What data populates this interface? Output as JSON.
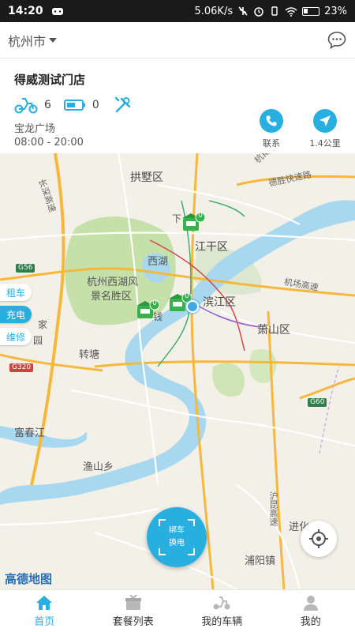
{
  "status_bar": {
    "time": "14:20",
    "speed": "5.06K/s",
    "battery": "23%"
  },
  "header": {
    "city": "杭州市"
  },
  "store": {
    "name": "得威测试门店",
    "vehicle_count": "6",
    "battery_count": "0",
    "address": "宝龙广场",
    "hours": "08:00 - 20:00",
    "actions": {
      "contact_label": "联系",
      "distance_label": "1.4公里"
    }
  },
  "map": {
    "labels": {
      "gongshu": "拱墅区",
      "jianggan": "江干区",
      "xihu": "西湖",
      "scenic_1": "杭州西湖风",
      "scenic_2": "景名胜区",
      "binjiang": "滨江区",
      "xiaoshan": "萧山区",
      "zhuantang": "转塘",
      "fuchunjiang": "富春江",
      "yushan": "渔山乡",
      "puyang": "浦阳镇",
      "jinhua": "进化",
      "changshen": "长深高速",
      "desheng": "德胜快速路",
      "airport": "机场高速",
      "hangyong": "杭甬高",
      "hukun": "沪昆高速",
      "qian": "钱",
      "xia": "下",
      "jia": "家",
      "yuan": "园"
    },
    "shields": {
      "g56": "G56",
      "g320": "G320",
      "g60": "G60"
    },
    "side_tabs": [
      "租车",
      "充电",
      "维修"
    ],
    "station_counts": [
      "0",
      "0",
      "0"
    ],
    "scan_button": {
      "line1": "绑车",
      "line2": "换电"
    },
    "provider": "高德地图"
  },
  "tabbar": {
    "items": [
      {
        "label": "首页",
        "icon": "home-icon"
      },
      {
        "label": "套餐列表",
        "icon": "package-icon"
      },
      {
        "label": "我的车辆",
        "icon": "scooter-icon"
      },
      {
        "label": "我的",
        "icon": "user-icon"
      }
    ]
  },
  "colors": {
    "accent": "#29aee0",
    "river": "#a8d8ef",
    "park": "#c5e0a8",
    "highway": "#f5b83d"
  }
}
